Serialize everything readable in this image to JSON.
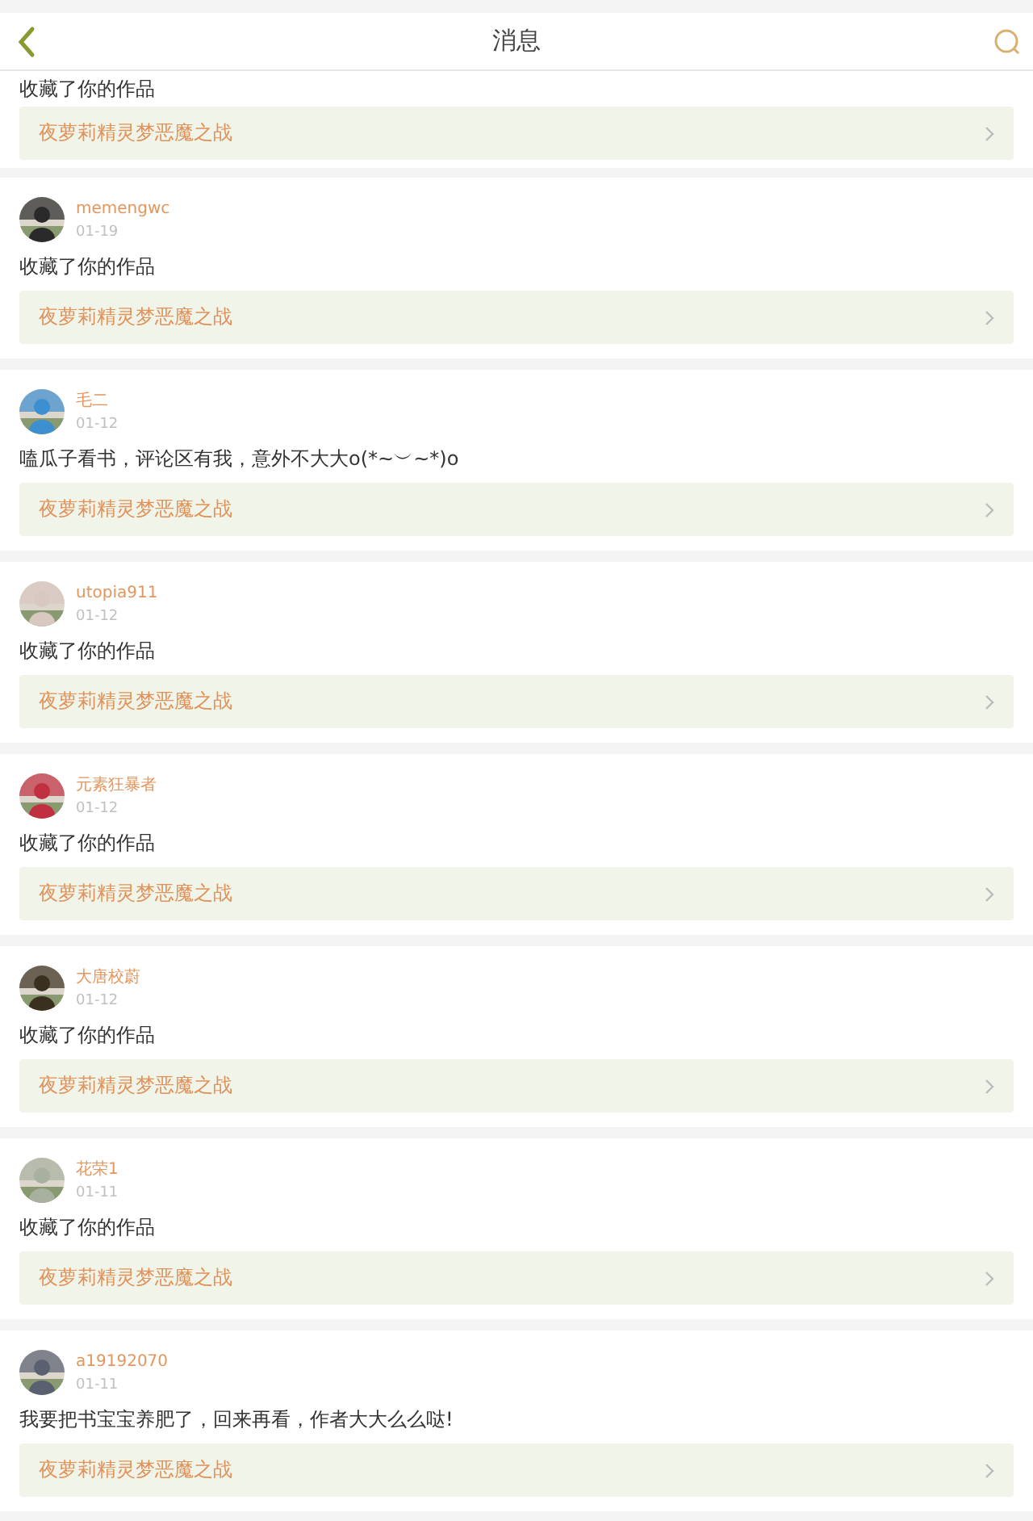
{
  "header": {
    "title": "消息"
  },
  "partial_message": {
    "comment": "收藏了你的作品",
    "book": "夜萝莉精灵梦恶魔之战"
  },
  "messages": [
    {
      "user": "memengwc",
      "date": "01-19",
      "comment": "收藏了你的作品",
      "book": "夜萝莉精灵梦恶魔之战"
    },
    {
      "user": "毛二",
      "date": "01-12",
      "comment": "嗑瓜子看书，评论区有我，意外不大大o(*~︶~*)o",
      "book": "夜萝莉精灵梦恶魔之战"
    },
    {
      "user": "utopia911",
      "date": "01-12",
      "comment": "收藏了你的作品",
      "book": "夜萝莉精灵梦恶魔之战"
    },
    {
      "user": "元素狂暴者",
      "date": "01-12",
      "comment": "收藏了你的作品",
      "book": "夜萝莉精灵梦恶魔之战"
    },
    {
      "user": "大唐校蔚",
      "date": "01-12",
      "comment": "收藏了你的作品",
      "book": "夜萝莉精灵梦恶魔之战"
    },
    {
      "user": "花荣1",
      "date": "01-11",
      "comment": "收藏了你的作品",
      "book": "夜萝莉精灵梦恶魔之战"
    },
    {
      "user": "a19192070",
      "date": "01-11",
      "comment": "我要把书宝宝养肥了，回来再看，作者大大么么哒!",
      "book": "夜萝莉精灵梦恶魔之战"
    }
  ]
}
